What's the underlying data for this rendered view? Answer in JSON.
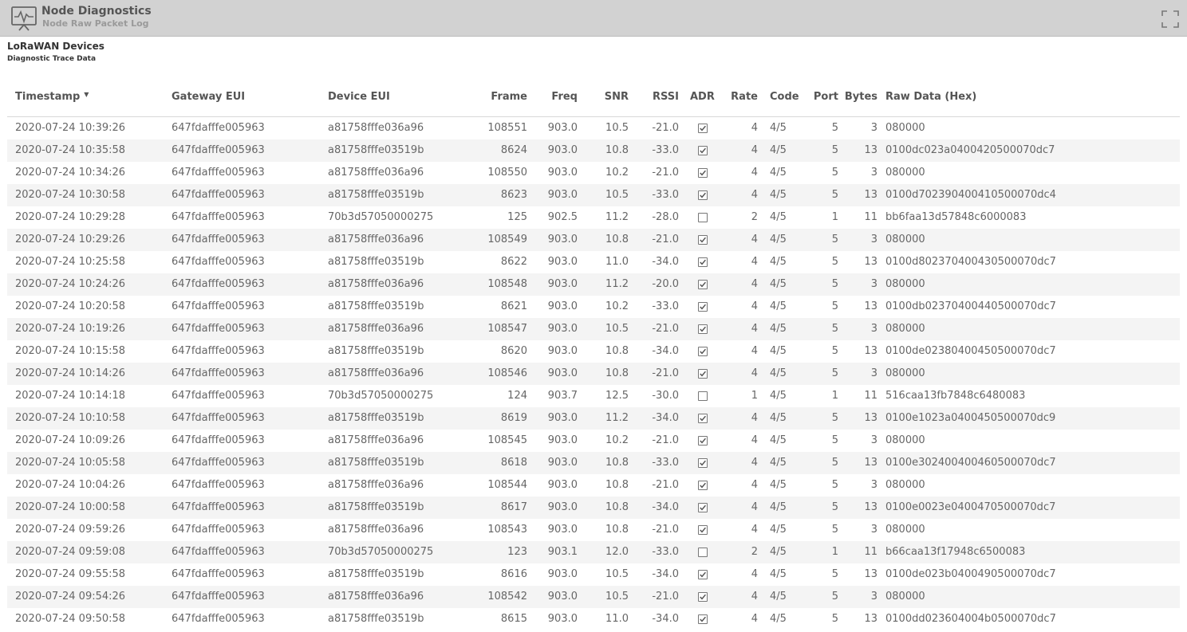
{
  "header": {
    "title": "Node Diagnostics",
    "subtitle": "Node Raw Packet Log"
  },
  "panel": {
    "title": "LoRaWAN Devices",
    "subtitle": "Diagnostic Trace Data"
  },
  "table": {
    "columns": [
      "Timestamp",
      "Gateway EUI",
      "Device EUI",
      "Frame",
      "Freq",
      "SNR",
      "RSSI",
      "ADR",
      "Rate",
      "Code",
      "Port",
      "Bytes",
      "Raw Data (Hex)"
    ],
    "sorted_column": "Timestamp",
    "rows": [
      {
        "ts": "2020-07-24 10:39:26",
        "gw": "647fdafffe005963",
        "dev": "a81758fffe036a96",
        "frame": "108551",
        "freq": "903.0",
        "snr": "10.5",
        "rssi": "-21.0",
        "adr": true,
        "rate": "4",
        "code": "4/5",
        "port": "5",
        "bytes": "3",
        "raw": "080000"
      },
      {
        "ts": "2020-07-24 10:35:58",
        "gw": "647fdafffe005963",
        "dev": "a81758fffe03519b",
        "frame": "8624",
        "freq": "903.0",
        "snr": "10.8",
        "rssi": "-33.0",
        "adr": true,
        "rate": "4",
        "code": "4/5",
        "port": "5",
        "bytes": "13",
        "raw": "0100dc023a0400420500070dc7"
      },
      {
        "ts": "2020-07-24 10:34:26",
        "gw": "647fdafffe005963",
        "dev": "a81758fffe036a96",
        "frame": "108550",
        "freq": "903.0",
        "snr": "10.2",
        "rssi": "-21.0",
        "adr": true,
        "rate": "4",
        "code": "4/5",
        "port": "5",
        "bytes": "3",
        "raw": "080000"
      },
      {
        "ts": "2020-07-24 10:30:58",
        "gw": "647fdafffe005963",
        "dev": "a81758fffe03519b",
        "frame": "8623",
        "freq": "903.0",
        "snr": "10.5",
        "rssi": "-33.0",
        "adr": true,
        "rate": "4",
        "code": "4/5",
        "port": "5",
        "bytes": "13",
        "raw": "0100d702390400410500070dc4"
      },
      {
        "ts": "2020-07-24 10:29:28",
        "gw": "647fdafffe005963",
        "dev": "70b3d57050000275",
        "frame": "125",
        "freq": "902.5",
        "snr": "11.2",
        "rssi": "-28.0",
        "adr": false,
        "rate": "2",
        "code": "4/5",
        "port": "1",
        "bytes": "11",
        "raw": "bb6faa13d57848c6000083"
      },
      {
        "ts": "2020-07-24 10:29:26",
        "gw": "647fdafffe005963",
        "dev": "a81758fffe036a96",
        "frame": "108549",
        "freq": "903.0",
        "snr": "10.8",
        "rssi": "-21.0",
        "adr": true,
        "rate": "4",
        "code": "4/5",
        "port": "5",
        "bytes": "3",
        "raw": "080000"
      },
      {
        "ts": "2020-07-24 10:25:58",
        "gw": "647fdafffe005963",
        "dev": "a81758fffe03519b",
        "frame": "8622",
        "freq": "903.0",
        "snr": "11.0",
        "rssi": "-34.0",
        "adr": true,
        "rate": "4",
        "code": "4/5",
        "port": "5",
        "bytes": "13",
        "raw": "0100d802370400430500070dc7"
      },
      {
        "ts": "2020-07-24 10:24:26",
        "gw": "647fdafffe005963",
        "dev": "a81758fffe036a96",
        "frame": "108548",
        "freq": "903.0",
        "snr": "11.2",
        "rssi": "-20.0",
        "adr": true,
        "rate": "4",
        "code": "4/5",
        "port": "5",
        "bytes": "3",
        "raw": "080000"
      },
      {
        "ts": "2020-07-24 10:20:58",
        "gw": "647fdafffe005963",
        "dev": "a81758fffe03519b",
        "frame": "8621",
        "freq": "903.0",
        "snr": "10.2",
        "rssi": "-33.0",
        "adr": true,
        "rate": "4",
        "code": "4/5",
        "port": "5",
        "bytes": "13",
        "raw": "0100db02370400440500070dc7"
      },
      {
        "ts": "2020-07-24 10:19:26",
        "gw": "647fdafffe005963",
        "dev": "a81758fffe036a96",
        "frame": "108547",
        "freq": "903.0",
        "snr": "10.5",
        "rssi": "-21.0",
        "adr": true,
        "rate": "4",
        "code": "4/5",
        "port": "5",
        "bytes": "3",
        "raw": "080000"
      },
      {
        "ts": "2020-07-24 10:15:58",
        "gw": "647fdafffe005963",
        "dev": "a81758fffe03519b",
        "frame": "8620",
        "freq": "903.0",
        "snr": "10.8",
        "rssi": "-34.0",
        "adr": true,
        "rate": "4",
        "code": "4/5",
        "port": "5",
        "bytes": "13",
        "raw": "0100de02380400450500070dc7"
      },
      {
        "ts": "2020-07-24 10:14:26",
        "gw": "647fdafffe005963",
        "dev": "a81758fffe036a96",
        "frame": "108546",
        "freq": "903.0",
        "snr": "10.8",
        "rssi": "-21.0",
        "adr": true,
        "rate": "4",
        "code": "4/5",
        "port": "5",
        "bytes": "3",
        "raw": "080000"
      },
      {
        "ts": "2020-07-24 10:14:18",
        "gw": "647fdafffe005963",
        "dev": "70b3d57050000275",
        "frame": "124",
        "freq": "903.7",
        "snr": "12.5",
        "rssi": "-30.0",
        "adr": false,
        "rate": "1",
        "code": "4/5",
        "port": "1",
        "bytes": "11",
        "raw": "516caa13fb7848c6480083"
      },
      {
        "ts": "2020-07-24 10:10:58",
        "gw": "647fdafffe005963",
        "dev": "a81758fffe03519b",
        "frame": "8619",
        "freq": "903.0",
        "snr": "11.2",
        "rssi": "-34.0",
        "adr": true,
        "rate": "4",
        "code": "4/5",
        "port": "5",
        "bytes": "13",
        "raw": "0100e1023a0400450500070dc9"
      },
      {
        "ts": "2020-07-24 10:09:26",
        "gw": "647fdafffe005963",
        "dev": "a81758fffe036a96",
        "frame": "108545",
        "freq": "903.0",
        "snr": "10.2",
        "rssi": "-21.0",
        "adr": true,
        "rate": "4",
        "code": "4/5",
        "port": "5",
        "bytes": "3",
        "raw": "080000"
      },
      {
        "ts": "2020-07-24 10:05:58",
        "gw": "647fdafffe005963",
        "dev": "a81758fffe03519b",
        "frame": "8618",
        "freq": "903.0",
        "snr": "10.8",
        "rssi": "-33.0",
        "adr": true,
        "rate": "4",
        "code": "4/5",
        "port": "5",
        "bytes": "13",
        "raw": "0100e302400400460500070dc7"
      },
      {
        "ts": "2020-07-24 10:04:26",
        "gw": "647fdafffe005963",
        "dev": "a81758fffe036a96",
        "frame": "108544",
        "freq": "903.0",
        "snr": "10.8",
        "rssi": "-21.0",
        "adr": true,
        "rate": "4",
        "code": "4/5",
        "port": "5",
        "bytes": "3",
        "raw": "080000"
      },
      {
        "ts": "2020-07-24 10:00:58",
        "gw": "647fdafffe005963",
        "dev": "a81758fffe03519b",
        "frame": "8617",
        "freq": "903.0",
        "snr": "10.8",
        "rssi": "-34.0",
        "adr": true,
        "rate": "4",
        "code": "4/5",
        "port": "5",
        "bytes": "13",
        "raw": "0100e0023e0400470500070dc7"
      },
      {
        "ts": "2020-07-24 09:59:26",
        "gw": "647fdafffe005963",
        "dev": "a81758fffe036a96",
        "frame": "108543",
        "freq": "903.0",
        "snr": "10.8",
        "rssi": "-21.0",
        "adr": true,
        "rate": "4",
        "code": "4/5",
        "port": "5",
        "bytes": "3",
        "raw": "080000"
      },
      {
        "ts": "2020-07-24 09:59:08",
        "gw": "647fdafffe005963",
        "dev": "70b3d57050000275",
        "frame": "123",
        "freq": "903.1",
        "snr": "12.0",
        "rssi": "-33.0",
        "adr": false,
        "rate": "2",
        "code": "4/5",
        "port": "1",
        "bytes": "11",
        "raw": "b66caa13f17948c6500083"
      },
      {
        "ts": "2020-07-24 09:55:58",
        "gw": "647fdafffe005963",
        "dev": "a81758fffe03519b",
        "frame": "8616",
        "freq": "903.0",
        "snr": "10.5",
        "rssi": "-34.0",
        "adr": true,
        "rate": "4",
        "code": "4/5",
        "port": "5",
        "bytes": "13",
        "raw": "0100de023b0400490500070dc7"
      },
      {
        "ts": "2020-07-24 09:54:26",
        "gw": "647fdafffe005963",
        "dev": "a81758fffe036a96",
        "frame": "108542",
        "freq": "903.0",
        "snr": "10.5",
        "rssi": "-21.0",
        "adr": true,
        "rate": "4",
        "code": "4/5",
        "port": "5",
        "bytes": "3",
        "raw": "080000"
      },
      {
        "ts": "2020-07-24 09:50:58",
        "gw": "647fdafffe005963",
        "dev": "a81758fffe03519b",
        "frame": "8615",
        "freq": "903.0",
        "snr": "11.0",
        "rssi": "-34.0",
        "adr": true,
        "rate": "4",
        "code": "4/5",
        "port": "5",
        "bytes": "13",
        "raw": "0100dd023604004b0500070dc7"
      }
    ]
  }
}
